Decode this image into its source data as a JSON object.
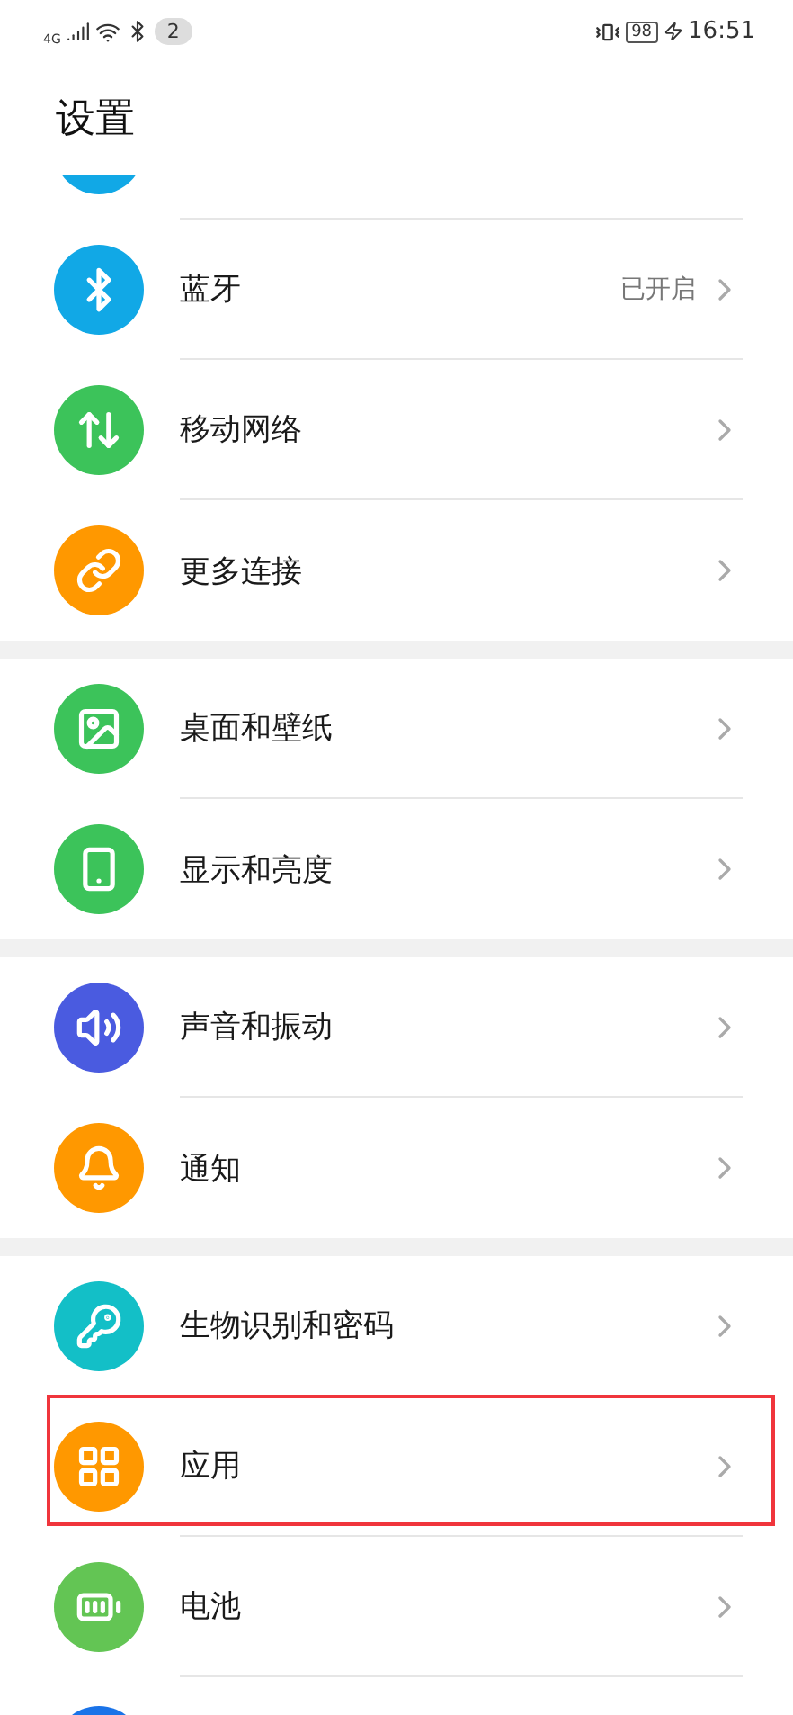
{
  "status_bar": {
    "network": "4G",
    "notification_count": "2",
    "battery": "98",
    "time": "16:51"
  },
  "title": "设置",
  "groups": [
    {
      "items": [
        {
          "kind": "partial",
          "color": "#11a8e6"
        },
        {
          "kind": "row",
          "color": "#11a8e6",
          "label": "蓝牙",
          "value": "已开启",
          "highlighted": false
        },
        {
          "kind": "row",
          "color": "#3cc35a",
          "label": "移动网络",
          "highlighted": false
        },
        {
          "kind": "row",
          "color": "#ff9800",
          "label": "更多连接",
          "highlighted": false
        }
      ]
    },
    {
      "items": [
        {
          "kind": "row",
          "color": "#3cc35a",
          "label": "桌面和壁纸",
          "highlighted": false
        },
        {
          "kind": "row",
          "color": "#3cc35a",
          "label": "显示和亮度",
          "highlighted": false
        }
      ]
    },
    {
      "items": [
        {
          "kind": "row",
          "color": "#4a5be0",
          "label": "声音和振动",
          "highlighted": false
        },
        {
          "kind": "row",
          "color": "#ff9800",
          "label": "通知",
          "highlighted": false
        }
      ]
    },
    {
      "items": [
        {
          "kind": "row",
          "color": "#13bfc7",
          "label": "生物识别和密码",
          "highlighted": false
        },
        {
          "kind": "row",
          "color": "#ff9800",
          "label": "应用",
          "highlighted": true
        },
        {
          "kind": "row",
          "color": "#63c554",
          "label": "电池",
          "highlighted": false
        },
        {
          "kind": "partial-top",
          "color": "#1a73e8"
        }
      ]
    }
  ]
}
